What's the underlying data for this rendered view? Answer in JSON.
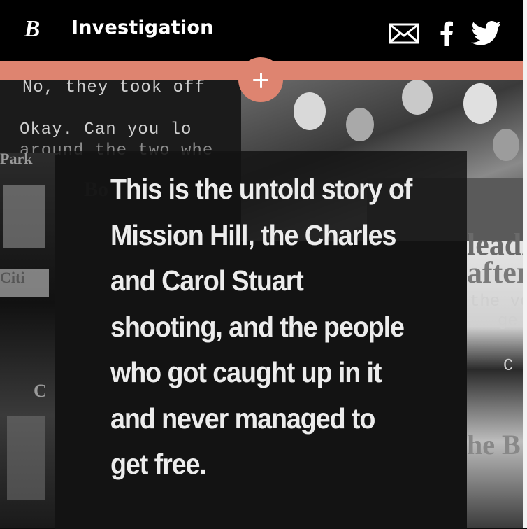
{
  "header": {
    "logo_glyph": "B",
    "section_title": "Investigation",
    "share_icons": [
      "mail-icon",
      "facebook-icon",
      "twitter-icon"
    ]
  },
  "colors": {
    "header_bg": "#000000",
    "accent": "#de8470",
    "headline_text": "#ececec",
    "card_bg": "#141414"
  },
  "expand_button_icon": "plus-icon",
  "collage": {
    "typewriter_lines": [
      "No, they took off",
      "Okay.  Can you lo",
      "around the two whe"
    ],
    "newsprint_fragments": [
      "leading woman",
      "after shooting in",
      "the ven",
      "ge",
      "C",
      "he B",
      "Park",
      "Bo",
      "Citi"
    ]
  },
  "story": {
    "headline": "This is the untold story of Mission Hill, the Charles and Carol Stuart shooting, and the people who got caught up in it and never managed to get free."
  }
}
